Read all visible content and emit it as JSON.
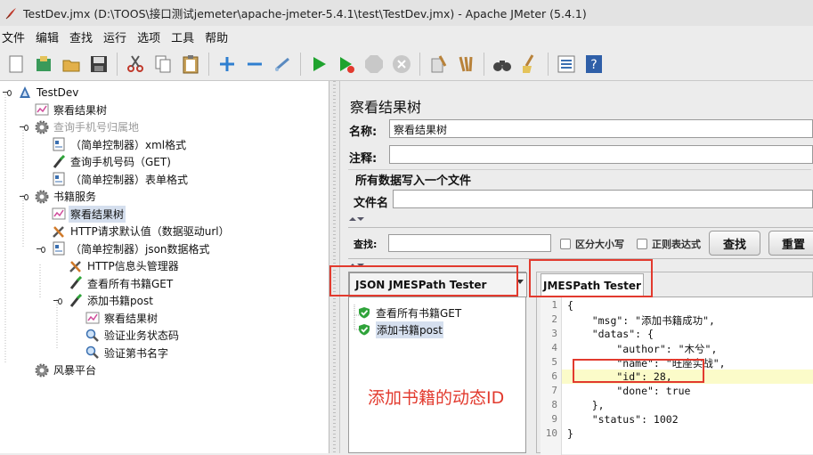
{
  "window": {
    "title": "TestDev.jmx (D:\\TOOS\\接口测试jemeter\\apache-jmeter-5.4.1\\test\\TestDev.jmx) - Apache JMeter (5.4.1)"
  },
  "menu": [
    "文件",
    "编辑",
    "查找",
    "运行",
    "选项",
    "工具",
    "帮助"
  ],
  "toolbar": [
    "new-icon",
    "templates-icon",
    "open-icon",
    "save-icon",
    "cut-icon",
    "copy-icon",
    "paste-icon",
    "expand-icon",
    "collapse-icon",
    "toggle-icon",
    "start-icon",
    "start-no-pause-icon",
    "stop-icon",
    "shutdown-icon",
    "clear-icon",
    "clear-all-icon",
    "search-icon",
    "reset-search-icon",
    "function-helper-icon",
    "help-icon"
  ],
  "tree": {
    "items": [
      {
        "label": "TestDev",
        "icon": "testplan-icon",
        "indent": 0
      },
      {
        "label": "察看结果树",
        "icon": "listener-icon",
        "indent": 1
      },
      {
        "label": "查询手机号归属地",
        "icon": "gear-icon",
        "indent": 1,
        "disabled": true
      },
      {
        "label": "（简单控制器）xml格式",
        "icon": "controller-icon",
        "indent": 2
      },
      {
        "label": "查询手机号码（GET)",
        "icon": "sampler-icon",
        "indent": 2
      },
      {
        "label": "（简单控制器）表单格式",
        "icon": "controller-icon",
        "indent": 2
      },
      {
        "label": "书籍服务",
        "icon": "gear-icon",
        "indent": 1
      },
      {
        "label": "察看结果树",
        "icon": "listener-icon",
        "indent": 2,
        "selected": true
      },
      {
        "label": "HTTP请求默认值（数据驱动url）",
        "icon": "config-icon",
        "indent": 2
      },
      {
        "label": "（简单控制器）json数据格式",
        "icon": "controller-icon",
        "indent": 2
      },
      {
        "label": "HTTP信息头管理器",
        "icon": "config-icon",
        "indent": 3
      },
      {
        "label": "查看所有书籍GET",
        "icon": "sampler-icon",
        "indent": 3
      },
      {
        "label": "添加书籍post",
        "icon": "sampler-icon",
        "indent": 3
      },
      {
        "label": "察看结果树",
        "icon": "listener-icon",
        "indent": 4
      },
      {
        "label": "验证业务状态码",
        "icon": "assertion-icon",
        "indent": 4
      },
      {
        "label": "验证第书名字",
        "icon": "assertion-icon",
        "indent": 4
      },
      {
        "label": "风暴平台",
        "icon": "gear-icon",
        "indent": 1
      }
    ]
  },
  "panel": {
    "title": "察看结果树",
    "name_label": "名称:",
    "name_value": "察看结果树",
    "comment_label": "注释:",
    "comment_value": "",
    "write_group_label": "所有数据写入一个文件",
    "filename_label": "文件名",
    "filename_value": ""
  },
  "search": {
    "label": "查找:",
    "value": "",
    "case_label": "区分大小写",
    "regex_label": "正则表达式",
    "find_button": "查找",
    "reset_button": "重置"
  },
  "results": {
    "renderer": "JSON JMESPath Tester",
    "items": [
      {
        "label": "查看所有书籍GET",
        "status": "success"
      },
      {
        "label": "添加书籍post",
        "status": "success",
        "selected": true
      }
    ],
    "tab": "JMESPath Tester",
    "code_lines": [
      "{",
      "    \"msg\": \"添加书籍成功\",",
      "    \"datas\": {",
      "        \"author\": \"木兮\",",
      "        \"name\": \"旺座实战\",",
      "        \"id\": 28,",
      "        \"done\": true",
      "    },",
      "    \"status\": 1002",
      "}"
    ],
    "highlighted_line": 6
  },
  "annotation": {
    "text": "添加书籍的动态ID",
    "color": "#e23a2e"
  },
  "colors": {
    "selection": "#d5dfee",
    "highlight": "#fbfbc9",
    "annotation_red": "#e23a2e"
  }
}
